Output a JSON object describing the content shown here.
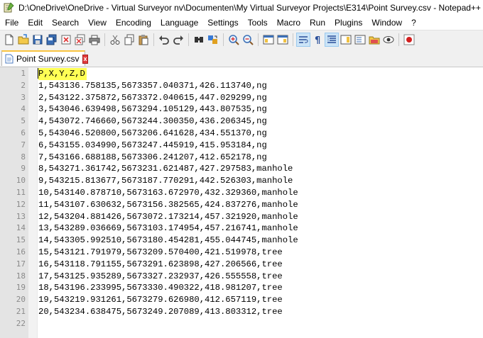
{
  "window": {
    "title": "D:\\OneDrive\\OneDrive - Virtual Surveyor nv\\Documenten\\My Virtual Surveyor Projects\\E314\\Point Survey.csv - Notepad++"
  },
  "menu": [
    "File",
    "Edit",
    "Search",
    "View",
    "Encoding",
    "Language",
    "Settings",
    "Tools",
    "Macro",
    "Run",
    "Plugins",
    "Window",
    "?"
  ],
  "toolbar": {
    "icons": [
      "new-file-icon",
      "open-file-icon",
      "save-icon",
      "save-all-icon",
      "close-icon",
      "close-all-icon",
      "print-icon",
      "cut-icon",
      "copy-icon",
      "paste-icon",
      "undo-icon",
      "redo-icon",
      "find-icon",
      "replace-icon",
      "zoom-in-icon",
      "zoom-out-icon",
      "sync-vertical-icon",
      "sync-horizontal-icon",
      "word-wrap-icon",
      "show-all-chars-icon",
      "indent-guide-icon",
      "document-map-icon",
      "function-list-icon",
      "folder-workspace-icon",
      "monitoring-icon",
      "record-macro-icon"
    ]
  },
  "tab": {
    "label": "Point Survey.csv",
    "close": "x"
  },
  "editor": {
    "lines": [
      "P,X,Y,Z,D",
      "1,543136.758135,5673357.040371,426.113740,ng",
      "2,543122.375872,5673372.040615,447.029299,ng",
      "3,543046.639498,5673294.105129,443.807535,ng",
      "4,543072.746660,5673244.300350,436.206345,ng",
      "5,543046.520800,5673206.641628,434.551370,ng",
      "6,543155.034990,5673247.445919,415.953184,ng",
      "7,543166.688188,5673306.241207,412.652178,ng",
      "8,543271.361742,5673231.621487,427.297583,manhole",
      "9,543215.813677,5673187.770291,442.526303,manhole",
      "10,543140.878710,5673163.672970,432.329360,manhole",
      "11,543107.630632,5673156.382565,424.837276,manhole",
      "12,543204.881426,5673072.173214,457.321920,manhole",
      "13,543289.036669,5673103.174954,457.216741,manhole",
      "14,543305.992510,5673180.454281,455.044745,manhole",
      "15,543121.791979,5673209.570400,421.519978,tree",
      "16,543118.791155,5673291.623898,427.206566,tree",
      "17,543125.935289,5673327.232937,426.555558,tree",
      "18,543196.233995,5673330.490322,418.981207,tree",
      "19,543219.931261,5673279.626980,412.657119,tree",
      "20,543234.638475,5673249.207089,413.803312,tree",
      ""
    ],
    "line_numbers": [
      "1",
      "2",
      "3",
      "4",
      "5",
      "6",
      "7",
      "8",
      "9",
      "10",
      "11",
      "12",
      "13",
      "14",
      "15",
      "16",
      "17",
      "18",
      "19",
      "20",
      "21",
      "22"
    ],
    "highlight_color": "#ffff55"
  },
  "colors": {
    "accent": "#f9c440",
    "gutter": "#e4e4e4"
  }
}
